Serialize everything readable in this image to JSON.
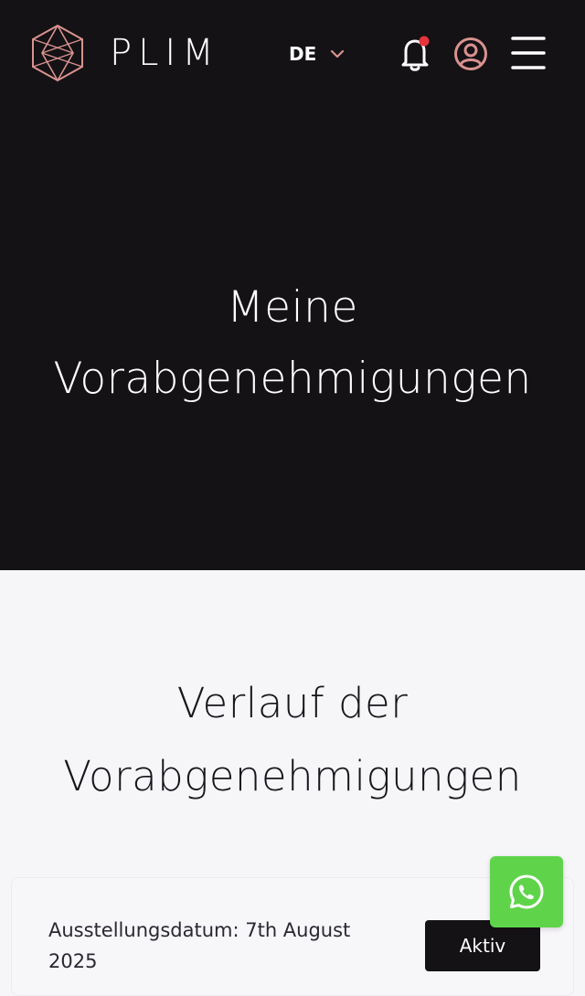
{
  "header": {
    "brand": "PLIM",
    "language": "DE",
    "notification_dot": true,
    "title": "Meine Vorabgenehmigungen"
  },
  "section": {
    "title": "Verlauf der Vorabgenehmigungen"
  },
  "approvals": [
    {
      "issue_date_label": "Ausstellungsdatum: 7th August 2025",
      "status": "Aktiv"
    }
  ],
  "colors": {
    "header_bg": "#141215",
    "page_bg": "#f6f5f8",
    "accent_pink": "#d9928f",
    "notification_red": "#e5343b",
    "whatsapp_green": "#5fd44a"
  },
  "icons": {
    "logo": "hexagon-logo-icon",
    "language_chevron": "chevron-down-icon",
    "notifications": "bell-icon",
    "account": "user-circle-icon",
    "menu": "hamburger-menu-icon",
    "chat": "whatsapp-icon"
  }
}
